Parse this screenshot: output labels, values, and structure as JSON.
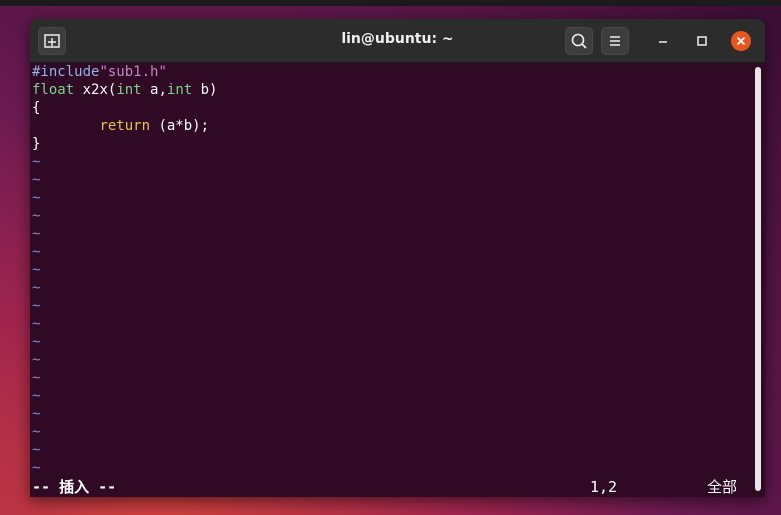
{
  "window": {
    "title": "lin@ubuntu: ~"
  },
  "icons": {
    "new_tab": "new-tab-icon",
    "search": "search-icon",
    "menu": "hamburger-menu-icon",
    "minimize": "minimize-icon",
    "maximize": "maximize-icon",
    "close": "close-icon"
  },
  "editor": {
    "lines": [
      {
        "parts": [
          {
            "t": "#include",
            "c": "pp"
          },
          {
            "t": "\"sub1.h\"",
            "c": "str"
          }
        ]
      },
      {
        "parts": [
          {
            "t": "float",
            "c": "kw"
          },
          {
            "t": " x2x(",
            "c": ""
          },
          {
            "t": "int",
            "c": "kw"
          },
          {
            "t": " a,",
            "c": ""
          },
          {
            "t": "int",
            "c": "kw"
          },
          {
            "t": " b)",
            "c": ""
          }
        ]
      },
      {
        "parts": [
          {
            "t": "{",
            "c": ""
          }
        ]
      },
      {
        "parts": [
          {
            "t": "        ",
            "c": ""
          },
          {
            "t": "return",
            "c": "ret"
          },
          {
            "t": " (a*b);",
            "c": ""
          }
        ]
      },
      {
        "parts": [
          {
            "t": "}",
            "c": ""
          }
        ]
      }
    ],
    "empty_marker": "~",
    "empty_line_count": 18
  },
  "statusline": {
    "mode": "-- 插入 --",
    "position": "1,2",
    "scroll": "全部"
  },
  "colors": {
    "terminal_bg": "#300a24",
    "close_button": "#e95420",
    "preprocessor": "#8fb4e8",
    "string": "#c586c0",
    "type_keyword": "#7fd18b",
    "statement_keyword": "#e6c54d",
    "tilde": "#7c8bd3"
  }
}
